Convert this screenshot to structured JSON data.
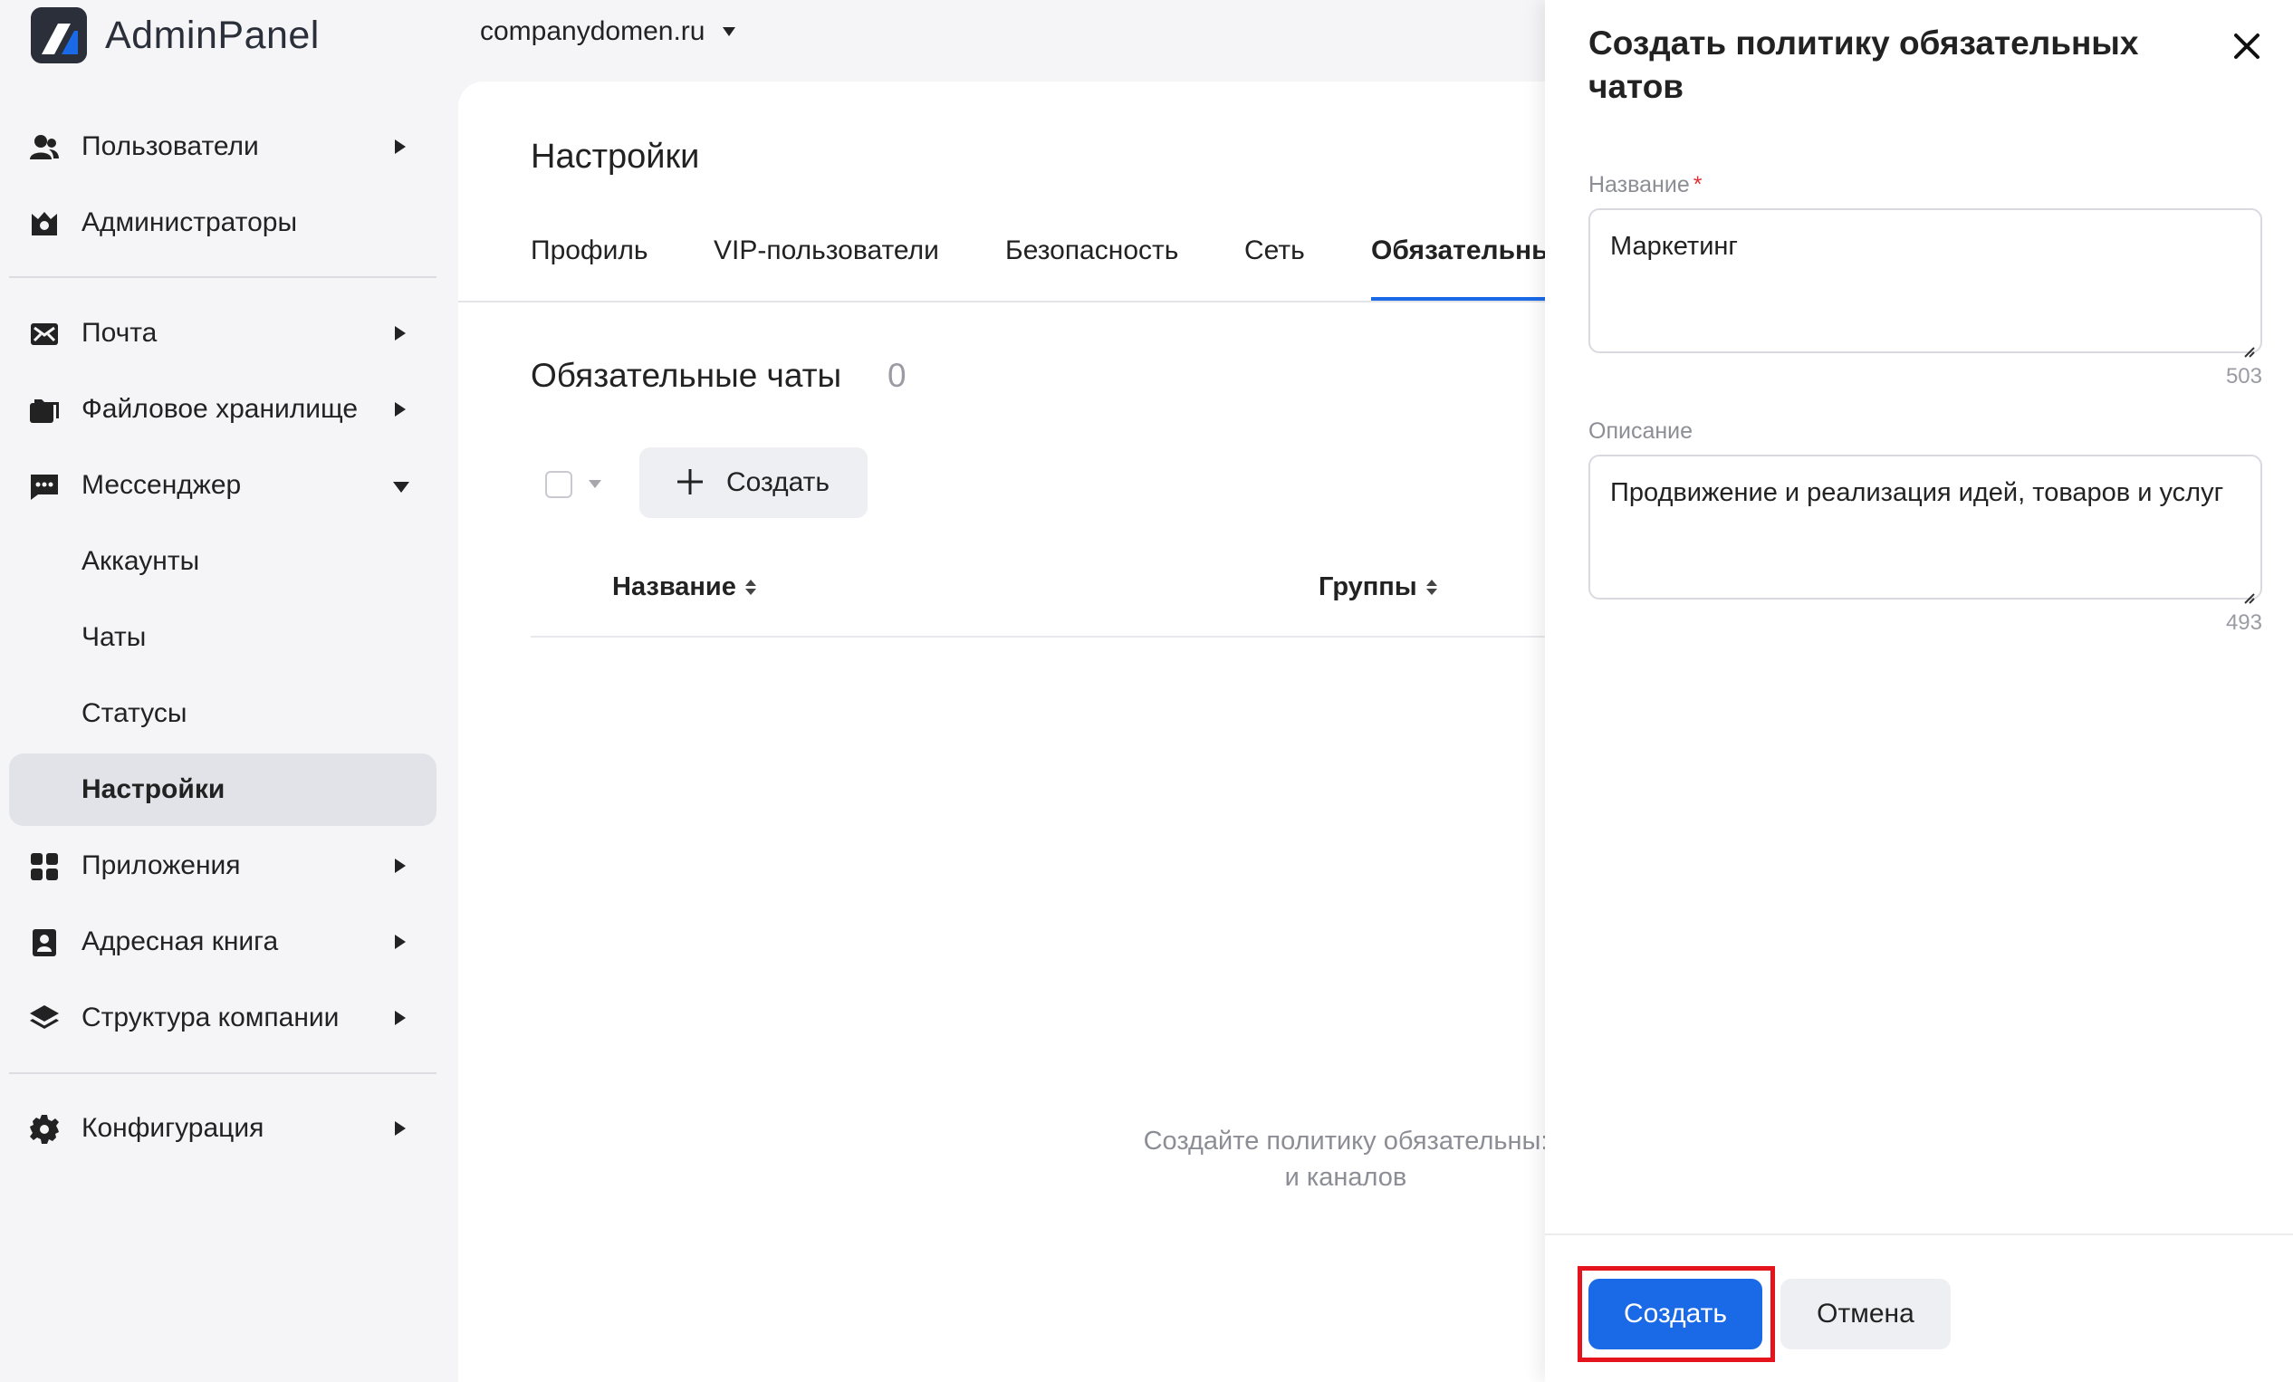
{
  "app": {
    "name": "AdminPanel",
    "logo_icon": "adminpanel-logo-icon"
  },
  "domain": {
    "label": "companydomen.ru",
    "icon": "chevron-down-icon"
  },
  "sidebar": {
    "items": [
      {
        "label": "Пользователи",
        "icon": "users-icon",
        "arrow": "right"
      },
      {
        "label": "Администраторы",
        "icon": "admin-crown-icon",
        "arrow": "none"
      },
      {
        "label": "Почта",
        "icon": "mail-icon",
        "arrow": "right"
      },
      {
        "label": "Файловое хранилище",
        "icon": "folder-icon",
        "arrow": "right"
      },
      {
        "label": "Мессенджер",
        "icon": "chat-icon",
        "arrow": "down"
      },
      {
        "label": "Аккаунты",
        "icon": "",
        "arrow": "none"
      },
      {
        "label": "Чаты",
        "icon": "",
        "arrow": "none"
      },
      {
        "label": "Статусы",
        "icon": "",
        "arrow": "none"
      },
      {
        "label": "Настройки",
        "icon": "",
        "arrow": "none",
        "active": true
      },
      {
        "label": "Приложения",
        "icon": "apps-grid-icon",
        "arrow": "right"
      },
      {
        "label": "Адресная книга",
        "icon": "contacts-book-icon",
        "arrow": "right"
      },
      {
        "label": "Структура компании",
        "icon": "layers-icon",
        "arrow": "right"
      },
      {
        "label": "Конфигурация",
        "icon": "gear-icon",
        "arrow": "right"
      }
    ]
  },
  "main": {
    "title": "Настройки",
    "tabs": [
      {
        "label": "Профиль"
      },
      {
        "label": "VIP-пользователи"
      },
      {
        "label": "Безопасность"
      },
      {
        "label": "Сеть"
      },
      {
        "label": "Обязательны",
        "active": true
      }
    ],
    "section_title": "Обязательные чаты",
    "section_count": "0",
    "create_button": "Создать",
    "columns": [
      {
        "label": "Название"
      },
      {
        "label": "Группы"
      }
    ],
    "empty_line1": "Создайте политику обязательны:",
    "empty_line2": "и каналов"
  },
  "drawer": {
    "title": "Создать политику обязательных чатов",
    "name_label": "Название",
    "name_required": "*",
    "name_value": "Маркетинг",
    "name_counter": "503",
    "desc_label": "Описание",
    "desc_value": "Продвижение и реализация идей, товаров и услуг",
    "desc_counter": "493",
    "submit_label": "Создать",
    "cancel_label": "Отмена"
  },
  "colors": {
    "accent": "#1a6ae8",
    "highlight": "#e3141b",
    "sidebar_bg": "#f5f5f7",
    "active_item_bg": "#e2e3e8"
  }
}
